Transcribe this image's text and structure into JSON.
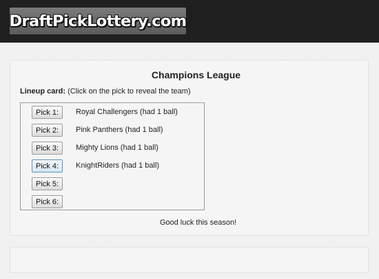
{
  "header": {
    "logo_text": "DraftPickLottery.com"
  },
  "main": {
    "title": "Champions League",
    "lineup_label_bold": "Lineup card:",
    "lineup_label_rest": " (Click on the pick to reveal the team)",
    "picks": [
      {
        "label": "Pick 1:",
        "team": "Royal Challengers (had 1 ball)"
      },
      {
        "label": "Pick 2:",
        "team": "Pink Panthers (had 1 ball)"
      },
      {
        "label": "Pick 3:",
        "team": "Mighty Lions (had 1 ball)"
      },
      {
        "label": "Pick 4:",
        "team": "KnightRiders (had 1 ball)"
      },
      {
        "label": "Pick 5:",
        "team": ""
      },
      {
        "label": "Pick 6:",
        "team": ""
      }
    ],
    "footer_message": "Good luck this season!"
  }
}
